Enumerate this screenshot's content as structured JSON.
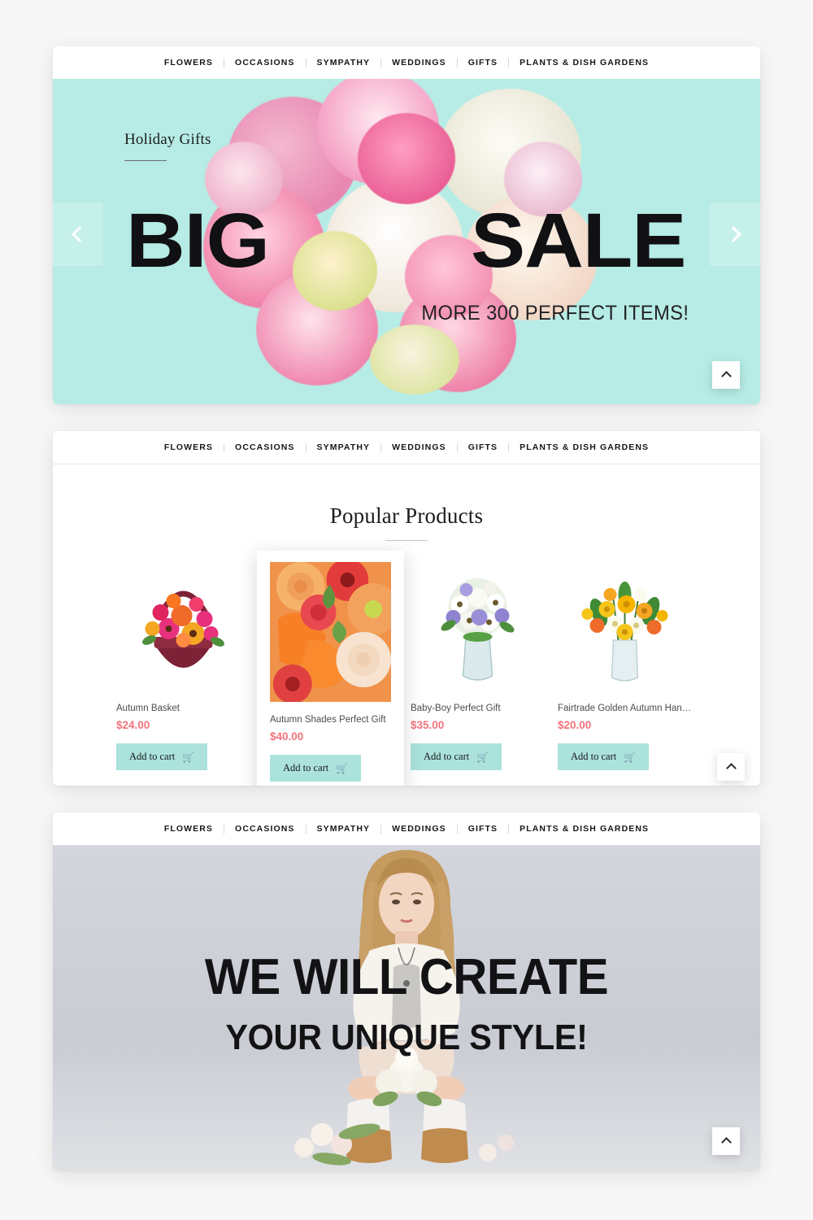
{
  "nav": {
    "items": [
      {
        "label": "FLOWERS"
      },
      {
        "label": "OCCASIONS"
      },
      {
        "label": "SYMPATHY"
      },
      {
        "label": "WEDDINGS"
      },
      {
        "label": "GIFTS"
      },
      {
        "label": "PLANTS & DISH GARDENS"
      }
    ]
  },
  "hero": {
    "eyebrow": "Holiday Gifts",
    "headline_left": "BIG",
    "headline_right": "SALE",
    "subheadline": "MORE 300 PERFECT ITEMS!",
    "prev_icon": "chevron-left-icon",
    "next_icon": "chevron-right-icon",
    "scroll_top_icon": "chevron-up-icon",
    "background_color": "#b6ece5"
  },
  "products_section": {
    "title": "Popular Products",
    "scroll_top_icon": "chevron-up-icon",
    "cart_icon": "shopping-cart-icon",
    "price_color": "#f2737c",
    "button_color": "#abe2dc",
    "items": [
      {
        "name": "Autumn Basket",
        "price": "$24.00",
        "add_label": "Add to cart",
        "featured": false
      },
      {
        "name": "Autumn Shades Perfect Gift",
        "price": "$40.00",
        "add_label": "Add to cart",
        "featured": true
      },
      {
        "name": "Baby-Boy Perfect Gift",
        "price": "$35.00",
        "add_label": "Add to cart",
        "featured": false
      },
      {
        "name": "Fairtrade Golden Autumn Hand t...",
        "price": "$20.00",
        "add_label": "Add to cart",
        "featured": false
      }
    ]
  },
  "style_section": {
    "headline": "WE WILL CREATE",
    "subheadline": "YOUR UNIQUE STYLE!",
    "scroll_top_icon": "chevron-up-icon"
  }
}
